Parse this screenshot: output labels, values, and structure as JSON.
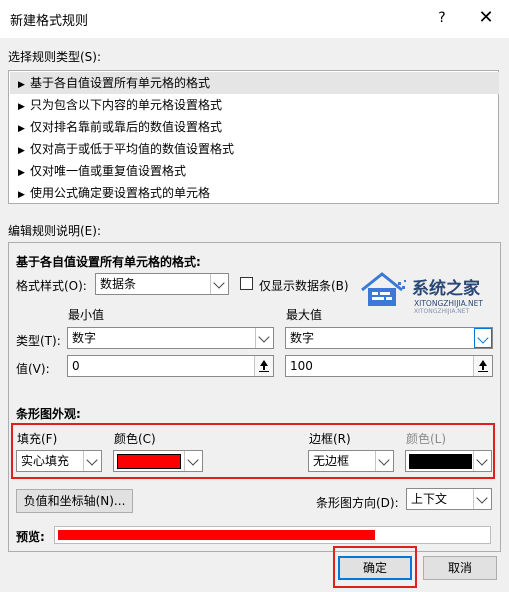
{
  "window": {
    "title": "新建格式规则",
    "help": "?",
    "close": "✕"
  },
  "rule_type": {
    "label": "选择规则类型(S):",
    "items": [
      "基于各自值设置所有单元格的格式",
      "只为包含以下内容的单元格设置格式",
      "仅对排名靠前或靠后的数值设置格式",
      "仅对高于或低于平均值的数值设置格式",
      "仅对唯一值或重复值设置格式",
      "使用公式确定要设置格式的单元格"
    ],
    "selected_index": 0
  },
  "edit": {
    "label": "编辑规则说明(E):",
    "heading": "基于各自值设置所有单元格的格式:",
    "format_style_label": "格式样式(O):",
    "format_style_value": "数据条",
    "show_bar_only_label": "仅显示数据条(B)",
    "min_label": "最小值",
    "max_label": "最大值",
    "type_label": "类型(T):",
    "value_label": "值(V):",
    "min_type": "数字",
    "max_type": "数字",
    "min_value": "0",
    "max_value": "100"
  },
  "bar_appearance": {
    "label": "条形图外观:",
    "fill_label": "填充(F)",
    "fill_value": "实心填充",
    "color_label": "颜色(C)",
    "fill_color": "#ff0000",
    "border_label": "边框(R)",
    "border_value": "无边框",
    "border_color_label": "颜色(L)",
    "border_color": "#000000",
    "axis_button": "负值和坐标轴(N)...",
    "direction_label": "条形图方向(D):",
    "direction_value": "上下文",
    "preview_label": "预览:",
    "preview_fill_fraction": 0.74
  },
  "buttons": {
    "ok": "确定",
    "cancel": "取消"
  },
  "watermark": {
    "name": "系统之家",
    "url": "XITONGZHIJIA.NET",
    "url2": "XITONGZHIJIA.NET"
  }
}
